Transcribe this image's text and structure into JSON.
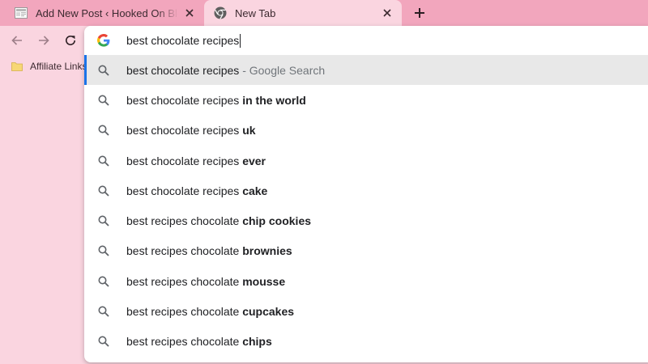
{
  "tabs": [
    {
      "title": "Add New Post ‹ Hooked On Blogging — WordPress",
      "active": false,
      "favicon": "page-thumbnail-icon"
    },
    {
      "title": "New Tab",
      "active": true,
      "favicon": "chrome-icon"
    }
  ],
  "toolbar": {
    "back_icon": "back-arrow-icon",
    "forward_icon": "forward-arrow-icon",
    "reload_icon": "reload-icon"
  },
  "bookmarks": [
    {
      "label": "Affiliate Links",
      "icon": "folder-icon"
    }
  ],
  "omnibox": {
    "query": "best chocolate recipes",
    "suggestions": [
      {
        "prefix": "best chocolate recipes",
        "suffix": "",
        "description": " - Google Search",
        "selected": true
      },
      {
        "prefix": "best chocolate recipes ",
        "suffix": "in the world",
        "description": "",
        "selected": false
      },
      {
        "prefix": "best chocolate recipes ",
        "suffix": "uk",
        "description": "",
        "selected": false
      },
      {
        "prefix": "best chocolate recipes ",
        "suffix": "ever",
        "description": "",
        "selected": false
      },
      {
        "prefix": "best chocolate recipes ",
        "suffix": "cake",
        "description": "",
        "selected": false
      },
      {
        "prefix": "best recipes chocolate ",
        "suffix": "chip cookies",
        "description": "",
        "selected": false
      },
      {
        "prefix": "best recipes chocolate ",
        "suffix": "brownies",
        "description": "",
        "selected": false
      },
      {
        "prefix": "best recipes chocolate ",
        "suffix": "mousse",
        "description": "",
        "selected": false
      },
      {
        "prefix": "best recipes chocolate ",
        "suffix": "cupcakes",
        "description": "",
        "selected": false
      },
      {
        "prefix": "best recipes chocolate ",
        "suffix": "chips",
        "description": "",
        "selected": false
      }
    ]
  },
  "colors": {
    "tabstrip": "#f2a6bd",
    "toolbar": "#fad5e0",
    "selected_row": "#e8e8e8",
    "accent": "#1a73e8"
  }
}
